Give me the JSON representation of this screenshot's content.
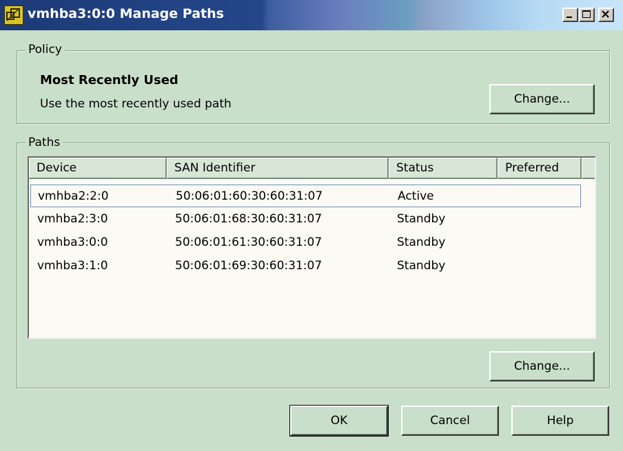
{
  "window": {
    "title": "vmhba3:0:0 Manage Paths",
    "icon": "vmware-app-icon",
    "buttons": [
      "minimize-icon",
      "maximize-icon",
      "close-icon"
    ]
  },
  "policy": {
    "legend": "Policy",
    "name": "Most Recently Used",
    "description": "Use the most recently used path",
    "change_label": "Change..."
  },
  "paths": {
    "legend": "Paths",
    "columns": [
      "Device",
      "SAN Identifier",
      "Status",
      "Preferred"
    ],
    "rows": [
      {
        "device": "vmhba2:2:0",
        "san": "50:06:01:60:30:60:31:07",
        "status": "Active",
        "preferred": ""
      },
      {
        "device": "vmhba2:3:0",
        "san": "50:06:01:68:30:60:31:07",
        "status": "Standby",
        "preferred": ""
      },
      {
        "device": "vmhba3:0:0",
        "san": "50:06:01:61:30:60:31:07",
        "status": "Standby",
        "preferred": ""
      },
      {
        "device": "vmhba3:1:0",
        "san": "50:06:01:69:30:60:31:07",
        "status": "Standby",
        "preferred": ""
      }
    ],
    "change_label": "Change..."
  },
  "footer": {
    "ok_label": "OK",
    "cancel_label": "Cancel",
    "help_label": "Help"
  },
  "colors": {
    "dialog_bg": "#c9dfc9",
    "titlebar_start": "#1d3a76",
    "list_bg": "#fbfaf4",
    "selection_border": "#6f8fb5"
  }
}
